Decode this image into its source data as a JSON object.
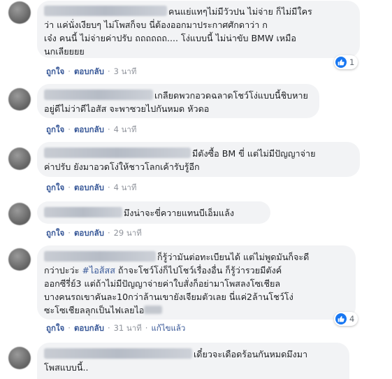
{
  "actions": {
    "like": "ถูกใจ",
    "reply": "ตอบกลับ",
    "edited": "แก้ไขแล้ว"
  },
  "comments": [
    {
      "lines": [
        "คนแย่แทๆไม่มีวัวปน ไม่จ่าย ก็ไม่มีใคร",
        "ว่า แค่นั่งเงียบๆ ไม่โพสก็จบ นี่ต้องออกมาประกาศศักดาว่า ก",
        "เจ๋ง คนนี้ ไม่จ่ายค่าปรับ ถถถถถถ.... โง่แบบนี้ ไม่น่าขับ BMW เหมือ",
        "นกเลียยยย"
      ],
      "time": "3 นาที",
      "likes": "1"
    },
    {
      "lines": [
        "เกลียดพวกอวดฉลาดโชว์โง่แบบนี้ชิบหาย",
        "อยู่ดีไม่ว่าดีไอสัส จะพาซวยไปกันหมด หัวดอ"
      ],
      "time": "4 นาที"
    },
    {
      "lines": [
        "มีตังซื้อ BM ขี่ แต่ไม่มีปัญญาจ่าย",
        "ค่าปรับ ยังมาอวดโง่ให้ชาวโลกเค้ารับรู้อีก"
      ],
      "time": "4 นาที"
    },
    {
      "lines": [
        "มึงน่าจะขี่ควายแทนบีเอ็มแล้ง"
      ],
      "time": "29 นาที"
    },
    {
      "lines": [
        "ก็รู้ว่ามันต่อทะเบียนได้ แต่ไม่พูดมันก็จะดี",
        "กว่าปะว่ะ",
        "#ไอส้สส",
        "ถ้าจะโชว์โง่ก็ไปโชว์เรื่องอื่น ก็รู้ว่ารวยมีตังค์",
        "ออกซีรี่ย์3 แต่ถ้าไม่มีปัญญาจ่ายค่าใบสั่งก็อย่ามาโพสลงโซเชียล",
        "บางคนรถเขาคันละ10กว่าล้านเขายังเจียมตัวเลย นี่แค่2ล้านโชว์โง่",
        "ซะโซเชียลลุกเป็นไฟเลยไอ"
      ],
      "time": "31 นาที",
      "likes": "4"
    },
    {
      "lines": [
        "เดี๋ยวจะเดือดร้อนกันหมดมึงมา",
        "โพสแบบนี้.."
      ]
    }
  ]
}
